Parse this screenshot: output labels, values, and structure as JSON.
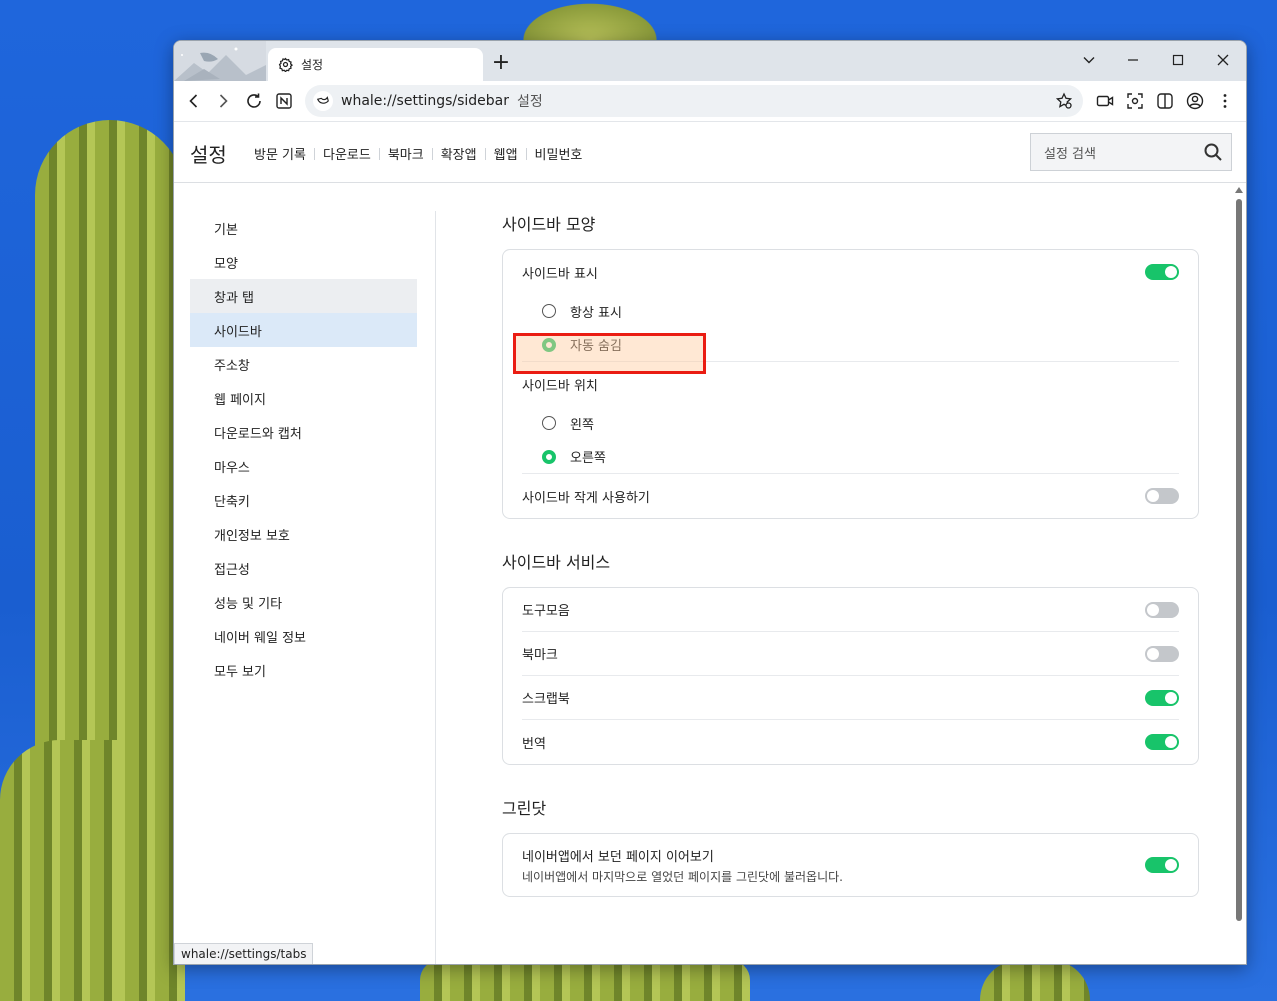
{
  "browser": {
    "tab_title": "설정",
    "new_tab_symbol": "+",
    "url": "whale://settings/sidebar",
    "page_name": "설정",
    "status_url": "whale://settings/tabs"
  },
  "header": {
    "title": "설정",
    "nav": [
      "방문 기록",
      "다운로드",
      "북마크",
      "확장앱",
      "웹앱",
      "비밀번호"
    ],
    "search_placeholder": "설정 검색"
  },
  "sidebar": {
    "items": [
      {
        "label": "기본",
        "state": "normal"
      },
      {
        "label": "모양",
        "state": "normal"
      },
      {
        "label": "창과 탭",
        "state": "hover"
      },
      {
        "label": "사이드바",
        "state": "active"
      },
      {
        "label": "주소창",
        "state": "normal"
      },
      {
        "label": "웹 페이지",
        "state": "normal"
      },
      {
        "label": "다운로드와 캡처",
        "state": "normal"
      },
      {
        "label": "마우스",
        "state": "normal"
      },
      {
        "label": "단축키",
        "state": "normal"
      },
      {
        "label": "개인정보 보호",
        "state": "normal"
      },
      {
        "label": "접근성",
        "state": "normal"
      },
      {
        "label": "성능 및 기타",
        "state": "normal"
      },
      {
        "label": "네이버 웨일 정보",
        "state": "normal"
      },
      {
        "label": "모두 보기",
        "state": "normal"
      }
    ]
  },
  "appearance": {
    "title": "사이드바 모양",
    "show_label": "사이드바 표시",
    "show_enabled": true,
    "show_options": [
      {
        "label": "항상 표시",
        "selected": false
      },
      {
        "label": "자동 숨김",
        "selected": true
      }
    ],
    "position_label": "사이드바 위치",
    "position_options": [
      {
        "label": "왼쪽",
        "selected": false
      },
      {
        "label": "오른쪽",
        "selected": true
      }
    ],
    "compact_label": "사이드바 작게 사용하기",
    "compact_enabled": false
  },
  "services": {
    "title": "사이드바 서비스",
    "items": [
      {
        "label": "도구모음",
        "enabled": false
      },
      {
        "label": "북마크",
        "enabled": false
      },
      {
        "label": "스크랩북",
        "enabled": true
      },
      {
        "label": "번역",
        "enabled": true
      }
    ]
  },
  "greendot": {
    "title": "그린닷",
    "item_label": "네이버앱에서 보던 페이지 이어보기",
    "item_desc": "네이버앱에서 마지막으로 열었던 페이지를 그린닷에 불러옵니다.",
    "enabled": true
  },
  "colors": {
    "accent_green": "#18c46a",
    "active_nav": "#dbe9f8",
    "highlight_border": "#ea1c12"
  }
}
